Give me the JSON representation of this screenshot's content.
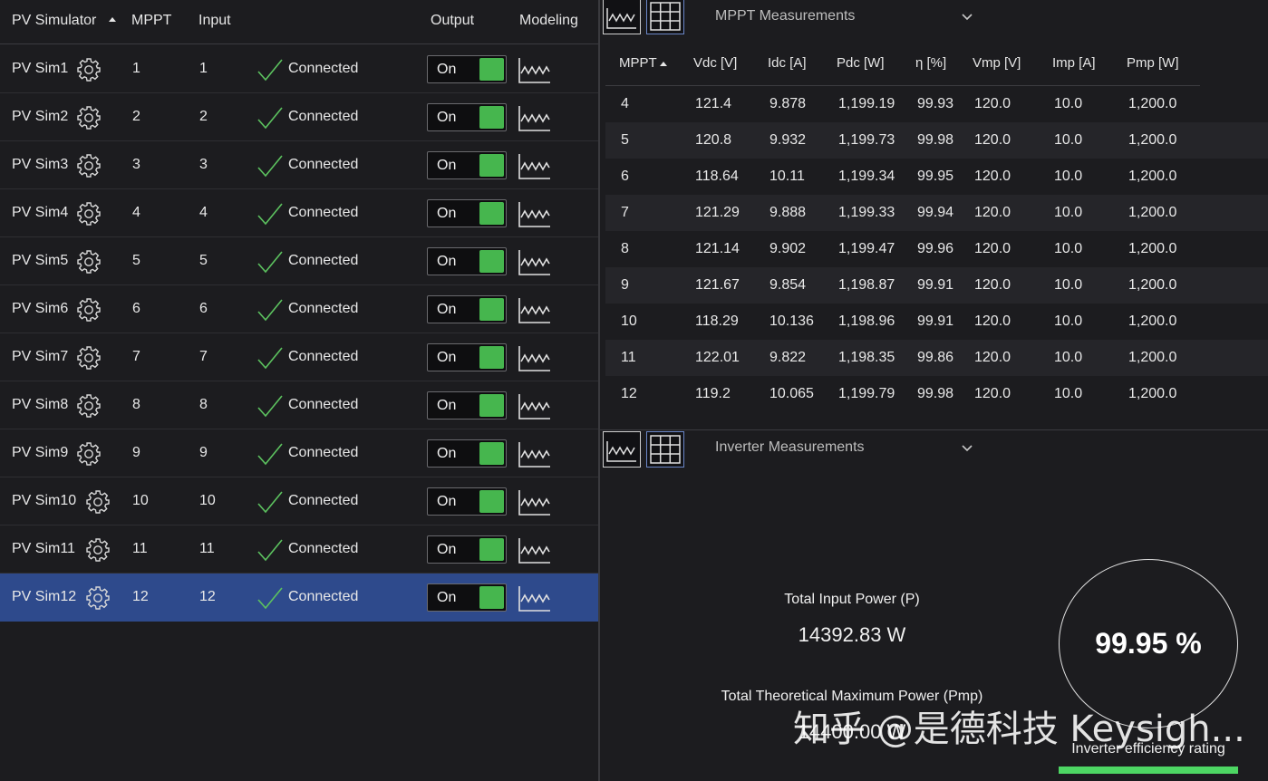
{
  "left_table": {
    "headers": {
      "pv_simulator": "PV Simulator",
      "mppt": "MPPT",
      "input": "Input",
      "output": "Output",
      "modeling": "Modeling"
    },
    "rows": [
      {
        "name": "PV Sim1",
        "mppt": "1",
        "input": "1",
        "status": "Connected",
        "output": "On"
      },
      {
        "name": "PV Sim2",
        "mppt": "2",
        "input": "2",
        "status": "Connected",
        "output": "On"
      },
      {
        "name": "PV Sim3",
        "mppt": "3",
        "input": "3",
        "status": "Connected",
        "output": "On"
      },
      {
        "name": "PV Sim4",
        "mppt": "4",
        "input": "4",
        "status": "Connected",
        "output": "On"
      },
      {
        "name": "PV Sim5",
        "mppt": "5",
        "input": "5",
        "status": "Connected",
        "output": "On"
      },
      {
        "name": "PV Sim6",
        "mppt": "6",
        "input": "6",
        "status": "Connected",
        "output": "On"
      },
      {
        "name": "PV Sim7",
        "mppt": "7",
        "input": "7",
        "status": "Connected",
        "output": "On"
      },
      {
        "name": "PV Sim8",
        "mppt": "8",
        "input": "8",
        "status": "Connected",
        "output": "On"
      },
      {
        "name": "PV Sim9",
        "mppt": "9",
        "input": "9",
        "status": "Connected",
        "output": "On"
      },
      {
        "name": "PV Sim10",
        "mppt": "10",
        "input": "10",
        "status": "Connected",
        "output": "On"
      },
      {
        "name": "PV Sim11",
        "mppt": "11",
        "input": "11",
        "status": "Connected",
        "output": "On"
      },
      {
        "name": "PV Sim12",
        "mppt": "12",
        "input": "12",
        "status": "Connected",
        "output": "On"
      }
    ]
  },
  "mppt_panel": {
    "title": "MPPT Measurements",
    "headers": [
      "MPPT",
      "Vdc [V]",
      "Idc [A]",
      "Pdc [W]",
      "η [%]",
      "Vmp [V]",
      "Imp [A]",
      "Pmp [W]"
    ],
    "rows": [
      [
        "4",
        "121.4",
        "9.878",
        "1,199.19",
        "99.93",
        "120.0",
        "10.0",
        "1,200.0"
      ],
      [
        "5",
        "120.8",
        "9.932",
        "1,199.73",
        "99.98",
        "120.0",
        "10.0",
        "1,200.0"
      ],
      [
        "6",
        "118.64",
        "10.11",
        "1,199.34",
        "99.95",
        "120.0",
        "10.0",
        "1,200.0"
      ],
      [
        "7",
        "121.29",
        "9.888",
        "1,199.33",
        "99.94",
        "120.0",
        "10.0",
        "1,200.0"
      ],
      [
        "8",
        "121.14",
        "9.902",
        "1,199.47",
        "99.96",
        "120.0",
        "10.0",
        "1,200.0"
      ],
      [
        "9",
        "121.67",
        "9.854",
        "1,198.87",
        "99.91",
        "120.0",
        "10.0",
        "1,200.0"
      ],
      [
        "10",
        "118.29",
        "10.136",
        "1,198.96",
        "99.91",
        "120.0",
        "10.0",
        "1,200.0"
      ],
      [
        "11",
        "122.01",
        "9.822",
        "1,198.35",
        "99.86",
        "120.0",
        "10.0",
        "1,200.0"
      ],
      [
        "12",
        "119.2",
        "10.065",
        "1,199.79",
        "99.98",
        "120.0",
        "10.0",
        "1,200.0"
      ]
    ]
  },
  "inverter_panel": {
    "title": "Inverter Measurements",
    "total_input_label": "Total Input Power (P)",
    "total_input_value": "14392.83 W",
    "total_theoretical_label": "Total Theoretical Maximum Power (Pmp)",
    "total_theoretical_value": "14400.00 W",
    "efficiency_value": "99.95 %",
    "efficiency_label": "Inverter efficiency rating",
    "efficiency_fraction": 0.9995
  },
  "watermark": "知乎 @是德科技 Keysigh...",
  "colors": {
    "background": "#1c1c1f",
    "selected_row": "#2e4a8c",
    "toggle_on": "#46b64e",
    "check": "#5cc25f",
    "efficiency_bar": "#4dd663"
  }
}
